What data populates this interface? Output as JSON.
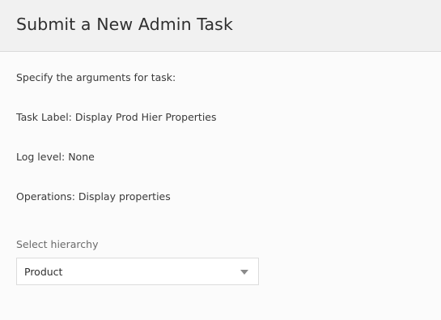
{
  "dialog": {
    "title": "Submit a New Admin Task"
  },
  "content": {
    "intro": "Specify the arguments for task:",
    "task_label": "Task Label: Display Prod Hier Properties",
    "log_level": "Log level: None",
    "operations": "Operations: Display properties"
  },
  "hierarchy_select": {
    "label": "Select hierarchy",
    "selected": "Product",
    "icon": "chevron-down-icon"
  }
}
